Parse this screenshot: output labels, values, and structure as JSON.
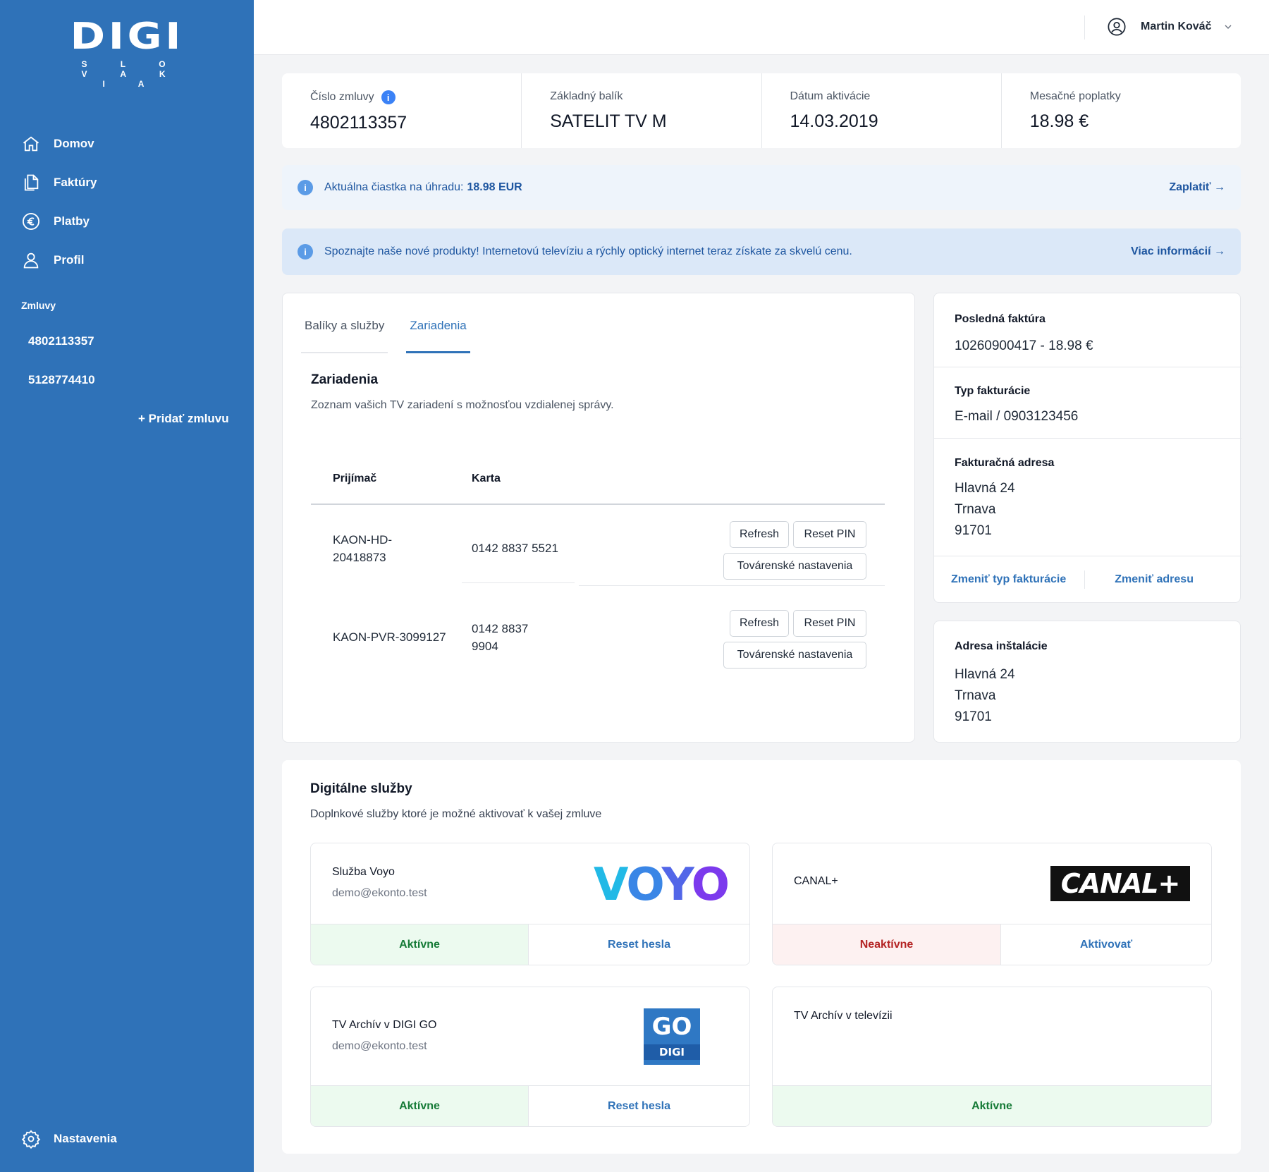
{
  "brand": {
    "name": "DIGI",
    "sub": "S L O V A K I A"
  },
  "sidebar": {
    "items": [
      {
        "label": "Domov",
        "icon": "home-icon"
      },
      {
        "label": "Faktúry",
        "icon": "documents-icon"
      },
      {
        "label": "Platby",
        "icon": "euro-icon"
      },
      {
        "label": "Profil",
        "icon": "user-icon"
      }
    ],
    "contracts_label": "Zmluvy",
    "contracts": [
      "4802113357",
      "5128774410"
    ],
    "add_contract": "+ Pridať zmluvu",
    "settings": "Nastavenia"
  },
  "header": {
    "user_name": "Martin Kováč"
  },
  "summary": {
    "contract_label": "Číslo zmluvy",
    "contract_value": "4802113357",
    "package_label": "Základný balík",
    "package_value": "SATELIT TV M",
    "activation_label": "Dátum aktivácie",
    "activation_value": "14.03.2019",
    "fees_label": "Mesačné poplatky",
    "fees_value": "18.98 €"
  },
  "alerts": {
    "payment_text": "Aktuálna čiastka na úhradu: ",
    "payment_amount": "18.98 EUR",
    "payment_link": "Zaplatiť →",
    "promo_text": "Spoznajte naše nové produkty! Internetovú televíziu a rýchly optický internet teraz získate za skvelú cenu.",
    "promo_link": "Viac informácií →"
  },
  "devices": {
    "tabs": [
      "Balíky a služby",
      "Zariadenia"
    ],
    "active_tab": "Zariadenia",
    "title": "Zariadenia",
    "subtitle": "Zoznam vašich TV zariadení s možnosťou vzdialenej správy.",
    "columns": [
      "Prijímač",
      "Karta"
    ],
    "rows": [
      {
        "receiver_1": "KAON-HD-",
        "receiver_2": "20418873",
        "card_1": "0142 8837 5521",
        "card_2": ""
      },
      {
        "receiver_1": "KAON-PVR-3099127",
        "receiver_2": "",
        "card_1": "0142 8837",
        "card_2": "9904"
      }
    ],
    "btn_refresh": "Refresh",
    "btn_reset_pin": "Reset PIN",
    "btn_factory": "Továrenské nastavenia"
  },
  "billing": {
    "last_invoice_label": "Posledná faktúra",
    "last_invoice_value": "10260900417 - 18.98 €",
    "billing_type_label": "Typ fakturácie",
    "billing_type_value": "E-mail / 0903123456",
    "address_label": "Fakturačná adresa",
    "address_lines": [
      "Hlavná 24",
      "Trnava",
      "91701"
    ],
    "change_type": "Zmeniť typ fakturácie",
    "change_address": "Zmeniť adresu"
  },
  "install": {
    "label": "Adresa inštalácie",
    "lines": [
      "Hlavná 24",
      "Trnava",
      "91701"
    ]
  },
  "digital": {
    "title": "Digitálne služby",
    "subtitle": "Doplnkové služby ktoré je možné aktivovať k vašej zmluve",
    "services": [
      {
        "name": "Služba Voyo",
        "email": "demo@ekonto.test",
        "status": "Aktívne",
        "action": "Reset hesla",
        "logo": "VOYO"
      },
      {
        "name": "CANAL+",
        "email": "",
        "status": "Neaktívne",
        "action": "Aktivovať",
        "logo": "CANAL+"
      },
      {
        "name": "TV Archív v DIGI GO",
        "email": "demo@ekonto.test",
        "status": "Aktívne",
        "action": "Reset hesla",
        "logo_top": "GO",
        "logo_bottom": "DIGI"
      },
      {
        "name": "TV Archív v televízii",
        "email": "",
        "status": "Aktívne",
        "action": ""
      }
    ],
    "colors": {
      "active_bg": "#ecfaef",
      "active_text": "#157a36",
      "inactive_bg": "#fdf1f1",
      "inactive_text": "#b42323"
    }
  },
  "colors": {
    "sidebar": "#2f72b8",
    "accent": "#2f72b8"
  }
}
